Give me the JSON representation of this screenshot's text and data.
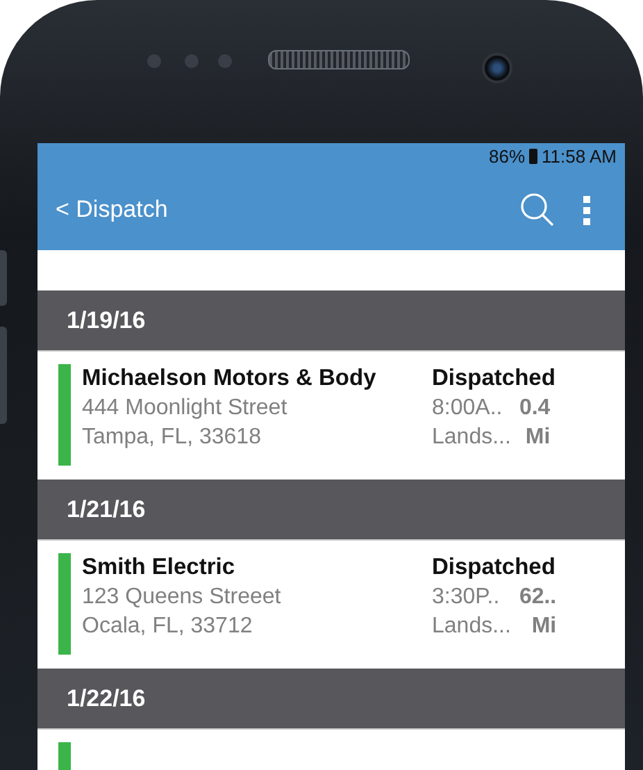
{
  "status_bar": {
    "battery": "86%",
    "time": "11:58 AM"
  },
  "app_bar": {
    "back": "< Dispatch"
  },
  "groups": [
    {
      "date": "1/19/16",
      "jobs": [
        {
          "name": "Michaelson Motors & Body",
          "address": "444 Moonlight Street",
          "city": "Tampa, FL, 33618",
          "status": "Dispatched",
          "time": "8:00A..",
          "distance": "0.4",
          "location": "Lands...",
          "unit": "Mi"
        }
      ]
    },
    {
      "date": "1/21/16",
      "jobs": [
        {
          "name": "Smith Electric",
          "address": "123 Queens Streeet",
          "city": "Ocala, FL, 33712",
          "status": "Dispatched",
          "time": "3:30P..",
          "distance": "62..",
          "location": "Lands...",
          "unit": "Mi"
        }
      ]
    },
    {
      "date": "1/22/16"
    }
  ]
}
